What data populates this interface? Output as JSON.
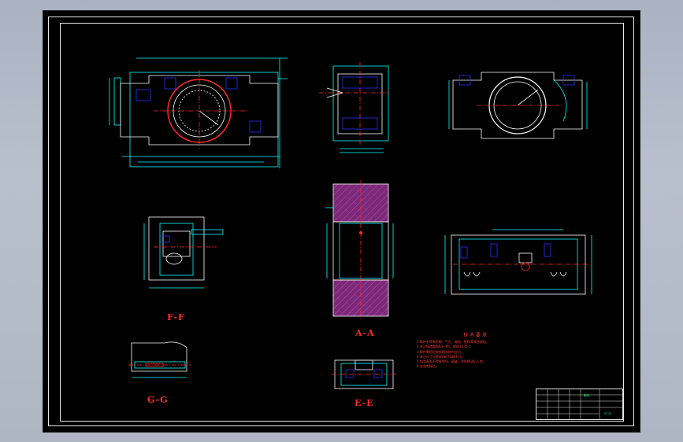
{
  "drawing": {
    "section_labels": {
      "f": "F-F",
      "a": "A-A",
      "g": "G-G",
      "e": "E-E"
    },
    "notes": {
      "title": "技术要求",
      "lines": [
        "1.铸件不得有砂眼、气孔、缩松、裂纹等铸造缺陷。",
        "2.未注铸造圆角R3~R5，倒角1×45°。",
        "3.铸件需经时效处理消除内应力。",
        "4.未注尺寸公差按GB/T1804-m。",
        "5.加工表面不得有划伤、磕碰，涂防锈油后入库。",
        "6.去毛刺锐边。"
      ]
    },
    "title_block": {
      "part_name": "箱体",
      "drawing_no": "XT-01"
    },
    "colors": {
      "background": "#000000",
      "outline": "#ffffff",
      "dimension": "#00ffff",
      "section_mark": "#ff2a2a",
      "hatch": "#9b2d8f",
      "bolt": "#2233ff",
      "notes_text": "#ff3a3a"
    }
  }
}
